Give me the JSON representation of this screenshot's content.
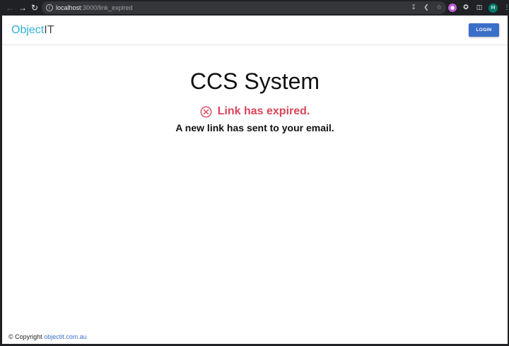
{
  "browser": {
    "url_host": "localhost",
    "url_path": ":3000/link_expired",
    "profile_initial": "M"
  },
  "header": {
    "brand_part1": "Object",
    "brand_part2": "IT",
    "login_label": "LOGIN"
  },
  "main": {
    "title": "CCS System",
    "status_text": "Link has expired.",
    "message": "A new link has sent to your email."
  },
  "footer": {
    "copyright": "© Copyright",
    "link_text": "objectit.com.au"
  },
  "colors": {
    "brand_accent": "#2fb1d6",
    "error": "#d9465a",
    "primary_button": "#3a6fc9"
  }
}
